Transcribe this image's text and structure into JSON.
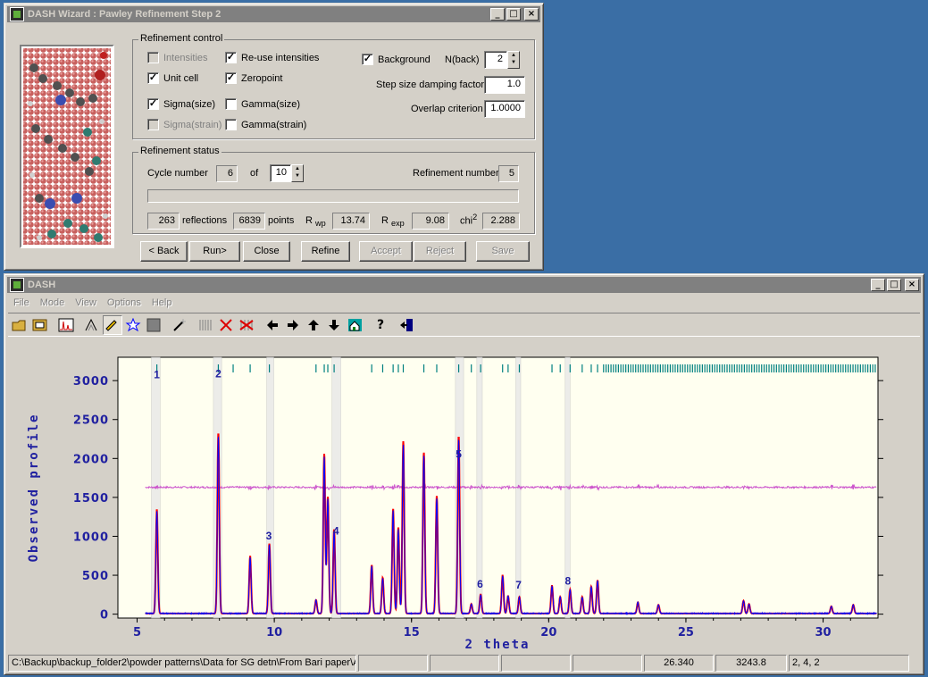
{
  "wizard": {
    "title": "DASH Wizard : Pawley Refinement Step 2",
    "refinement_control": {
      "legend": "Refinement control",
      "intensities": "Intensities",
      "reuse_intensities": "Re-use intensities",
      "unit_cell": "Unit cell",
      "zeropoint": "Zeropoint",
      "sigma_size": "Sigma(size)",
      "gamma_size": "Gamma(size)",
      "sigma_strain": "Sigma(strain)",
      "gamma_strain": "Gamma(strain)",
      "background": "Background",
      "nback_label": "N(back)",
      "nback_value": "2",
      "step_damping_label": "Step size damping factor",
      "step_damping_value": "1.0",
      "overlap_label": "Overlap criterion",
      "overlap_value": "1.0000"
    },
    "refinement_status": {
      "legend": "Refinement status",
      "cycle_label": "Cycle number",
      "cycle_value": "6",
      "of_label": "of",
      "of_value": "10",
      "refinement_number_label": "Refinement number",
      "refinement_number_value": "5",
      "reflections_value": "263",
      "reflections_label": "reflections",
      "points_value": "6839",
      "points_label": "points",
      "rwp_label": "R",
      "rwp_sub": "wp",
      "rwp_value": "13.74",
      "rexp_label": "R",
      "rexp_sub": "exp",
      "rexp_value": "9.08",
      "chi_label": "chi",
      "chi_sup": "2",
      "chi_value": "2.288"
    },
    "buttons": {
      "back": "< Back",
      "run": "Run>",
      "close": "Close",
      "refine": "Refine",
      "accept": "Accept",
      "reject": "Reject",
      "save": "Save"
    }
  },
  "main": {
    "title": "DASH",
    "menu": [
      "File",
      "Mode",
      "View",
      "Options",
      "Help"
    ],
    "toolbar_icons": [
      "open-file-icon",
      "open-project-icon",
      "pattern-icon",
      "peak-fit-icon",
      "pencil-icon",
      "star-icon",
      "stop-icon",
      "wand-icon",
      "grid-icon",
      "delete-icon",
      "clear-icon",
      "arrow-left-icon",
      "arrow-right-icon",
      "arrow-up-icon",
      "arrow-down-icon",
      "home-icon",
      "help-icon",
      "exit-icon"
    ],
    "status": {
      "path": "C:\\Backup\\backup_folder2\\powder patterns\\Data for SG detn\\From Bari paper\\A",
      "empty1": "",
      "empty2": "",
      "empty3": "",
      "empty4": "",
      "x_coord": "26.340",
      "y_coord": "3243.8",
      "hkl": "2, 4, 2"
    }
  },
  "colors": {
    "title_inactive": "#808080",
    "desktop": "#3a6ea5",
    "plot_bg": "#fffff0",
    "obs": "#0000ff",
    "calc": "#ff0000",
    "diff": "#cc55cc",
    "tick": "#008080",
    "axis_label": "#2020a0"
  },
  "chart_data": {
    "type": "line",
    "xlabel": "2 theta",
    "ylabel": "Observed profile",
    "xlim": [
      4.3,
      32.0
    ],
    "ylim": [
      -50,
      3300
    ],
    "x_ticks": [
      5,
      10,
      15,
      20,
      25,
      30
    ],
    "y_ticks": [
      0,
      500,
      1000,
      1500,
      2000,
      2500,
      3000
    ],
    "difference_offset": 1630,
    "peaks": [
      {
        "x": 5.72,
        "y": 1310
      },
      {
        "x": 7.96,
        "y": 2270
      },
      {
        "x": 9.12,
        "y": 720
      },
      {
        "x": 9.82,
        "y": 880
      },
      {
        "x": 11.52,
        "y": 170
      },
      {
        "x": 11.82,
        "y": 2010
      },
      {
        "x": 11.95,
        "y": 1470
      },
      {
        "x": 12.18,
        "y": 1060
      },
      {
        "x": 13.55,
        "y": 610
      },
      {
        "x": 13.95,
        "y": 450
      },
      {
        "x": 14.33,
        "y": 1320
      },
      {
        "x": 14.52,
        "y": 1080
      },
      {
        "x": 14.7,
        "y": 2170
      },
      {
        "x": 15.45,
        "y": 2030
      },
      {
        "x": 15.92,
        "y": 1480
      },
      {
        "x": 16.72,
        "y": 2230
      },
      {
        "x": 17.18,
        "y": 120
      },
      {
        "x": 17.52,
        "y": 240
      },
      {
        "x": 18.32,
        "y": 480
      },
      {
        "x": 18.52,
        "y": 220
      },
      {
        "x": 18.93,
        "y": 210
      },
      {
        "x": 20.12,
        "y": 350
      },
      {
        "x": 20.42,
        "y": 210
      },
      {
        "x": 20.78,
        "y": 300
      },
      {
        "x": 21.22,
        "y": 210
      },
      {
        "x": 21.55,
        "y": 340
      },
      {
        "x": 21.78,
        "y": 420
      },
      {
        "x": 23.25,
        "y": 140
      },
      {
        "x": 24.0,
        "y": 110
      },
      {
        "x": 27.1,
        "y": 160
      },
      {
        "x": 27.3,
        "y": 120
      },
      {
        "x": 30.3,
        "y": 90
      },
      {
        "x": 31.1,
        "y": 110
      }
    ],
    "excluded_regions": [
      [
        5.52,
        5.84
      ],
      [
        7.78,
        8.08
      ],
      [
        9.72,
        9.98
      ],
      [
        12.1,
        12.42
      ],
      [
        16.6,
        16.9
      ],
      [
        17.38,
        17.58
      ],
      [
        18.8,
        18.98
      ],
      [
        20.6,
        20.78
      ]
    ],
    "region_labels": [
      {
        "label": "1",
        "x": 5.72,
        "y": 3030
      },
      {
        "label": "2",
        "x": 7.96,
        "y": 3040
      },
      {
        "label": "3",
        "x": 9.8,
        "y": 960
      },
      {
        "label": "4",
        "x": 12.25,
        "y": 1020
      },
      {
        "label": "5",
        "x": 16.72,
        "y": 2010
      },
      {
        "label": "6",
        "x": 17.5,
        "y": 340
      },
      {
        "label": "7",
        "x": 18.9,
        "y": 330
      },
      {
        "label": "8",
        "x": 20.7,
        "y": 380
      }
    ],
    "reflection_ticks": [
      5.72,
      7.96,
      8.5,
      9.12,
      9.82,
      11.52,
      11.82,
      11.95,
      12.18,
      13.55,
      13.95,
      14.33,
      14.52,
      14.7,
      15.45,
      15.92,
      16.72,
      17.18,
      17.52,
      18.32,
      18.52,
      18.93,
      20.12,
      20.42,
      20.78,
      21.22,
      21.55,
      21.78
    ]
  }
}
